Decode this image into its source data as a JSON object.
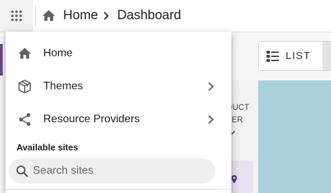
{
  "topbar": {
    "apps_icon": "apps-grid-icon",
    "breadcrumb": {
      "home_icon": "home-icon",
      "home_label": "Home",
      "separator_icon": "chevron-right-icon",
      "current_label": "Dashboard"
    }
  },
  "background": {
    "view_toggle": {
      "list_icon": "list-view-icon",
      "list_label": "LIST"
    },
    "card_text_line1": "DUCT",
    "card_text_line2": "TER",
    "card_icon": "location-pin-icon"
  },
  "menu": {
    "items": [
      {
        "label": "Home",
        "icon": "home-icon",
        "has_submenu": false
      },
      {
        "label": "Themes",
        "icon": "theme-box-icon",
        "has_submenu": true
      },
      {
        "label": "Resource Providers",
        "icon": "share-icon",
        "has_submenu": true
      }
    ],
    "available_sites_heading": "Available sites",
    "search": {
      "placeholder": "Search sites",
      "value": ""
    }
  },
  "colors": {
    "accent_purple": "#6e4a8e",
    "panel_blue": "#a9d1dc",
    "icon_gray": "#5f5f5f"
  }
}
